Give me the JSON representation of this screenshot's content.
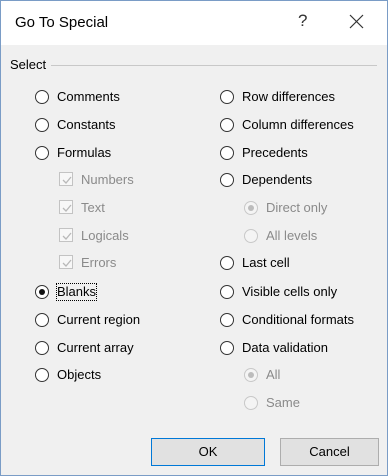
{
  "window": {
    "title": "Go To Special",
    "help_glyph": "?"
  },
  "group": {
    "label": "Select"
  },
  "left_options": [
    {
      "label": "Comments",
      "checked": false
    },
    {
      "label": "Constants",
      "checked": false
    },
    {
      "label": "Formulas",
      "checked": false
    },
    {
      "label": "Blanks",
      "checked": true
    },
    {
      "label": "Current region",
      "checked": false
    },
    {
      "label": "Current array",
      "checked": false
    },
    {
      "label": "Objects",
      "checked": false
    }
  ],
  "formula_types": [
    {
      "label": "Numbers",
      "checked": true
    },
    {
      "label": "Text",
      "checked": true
    },
    {
      "label": "Logicals",
      "checked": true
    },
    {
      "label": "Errors",
      "checked": true
    }
  ],
  "right_options": [
    {
      "label": "Row differences",
      "checked": false
    },
    {
      "label": "Column differences",
      "checked": false
    },
    {
      "label": "Precedents",
      "checked": false
    },
    {
      "label": "Dependents",
      "checked": false
    },
    {
      "label": "Last cell",
      "checked": false
    },
    {
      "label": "Visible cells only",
      "checked": false
    },
    {
      "label": "Conditional formats",
      "checked": false
    },
    {
      "label": "Data validation",
      "checked": false
    }
  ],
  "dependents_sub": [
    {
      "label": "Direct only",
      "checked": true
    },
    {
      "label": "All levels",
      "checked": false
    }
  ],
  "validation_sub": [
    {
      "label": "All",
      "checked": true
    },
    {
      "label": "Same",
      "checked": false
    }
  ],
  "buttons": {
    "ok": "OK",
    "cancel": "Cancel"
  }
}
